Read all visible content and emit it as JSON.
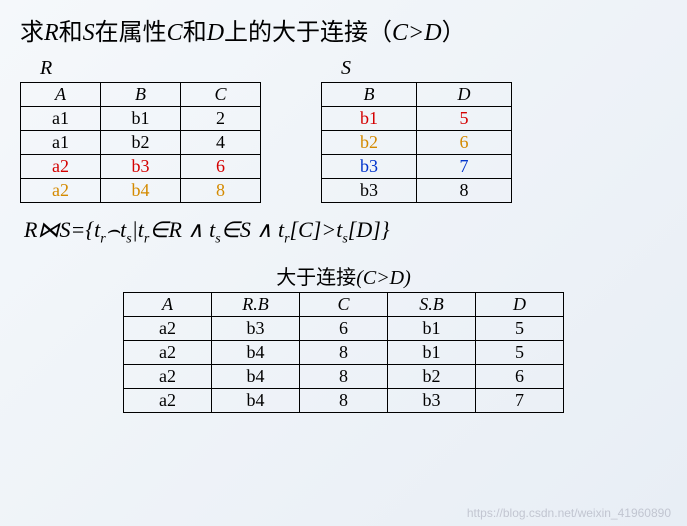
{
  "title_parts": {
    "p1": "求",
    "r": "R",
    "p2": "和",
    "s": "S",
    "p3": "在属性",
    "c": "C",
    "p4": "和",
    "d": "D",
    "p5": "上的大于连接（",
    "cond": "C>D",
    "p6": "）"
  },
  "tableR": {
    "label": "R",
    "headers": [
      "A",
      "B",
      "C"
    ],
    "rows": [
      {
        "cells": [
          "a1",
          "b1",
          "2"
        ],
        "color": "black"
      },
      {
        "cells": [
          "a1",
          "b2",
          "4"
        ],
        "color": "black"
      },
      {
        "cells": [
          "a2",
          "b3",
          "6"
        ],
        "color": "red"
      },
      {
        "cells": [
          "a2",
          "b4",
          "8"
        ],
        "color": "orange"
      }
    ]
  },
  "tableS": {
    "label": "S",
    "headers": [
      "B",
      "D"
    ],
    "rows": [
      {
        "cells": [
          "b1",
          "5"
        ],
        "color": "red"
      },
      {
        "cells": [
          "b2",
          "6"
        ],
        "color": "orange"
      },
      {
        "cells": [
          "b3",
          "7"
        ],
        "color": "blue"
      },
      {
        "cells": [
          "b3",
          "8"
        ],
        "color": "black"
      }
    ]
  },
  "formula": {
    "lhs_r": "R",
    "join": "⋈",
    "lhs_s": "S",
    "eq": "=",
    "body": "{t",
    "sub_r": "r",
    "cap": "⌢",
    "t2": "t",
    "sub_s": "s",
    "bar": "|t",
    "in1": "∈",
    "R": "R",
    "and1": "∧",
    "t3": " t",
    "in2": "∈",
    "S": "S",
    "and2": "∧",
    "t4": " t",
    "br1": "[C]",
    "gt": ">",
    "t5": "t",
    "br2": "[D]",
    "close": "}"
  },
  "result": {
    "title_cn": "大于连接",
    "title_cond": "(C>D)",
    "headers": [
      "A",
      "R.B",
      "C",
      "S.B",
      "D"
    ],
    "rows": [
      [
        "a2",
        "b3",
        "6",
        "b1",
        "5"
      ],
      [
        "a2",
        "b4",
        "8",
        "b1",
        "5"
      ],
      [
        "a2",
        "b4",
        "8",
        "b2",
        "6"
      ],
      [
        "a2",
        "b4",
        "8",
        "b3",
        "7"
      ]
    ]
  },
  "watermark": "https://blog.csdn.net/weixin_41960890",
  "chart_data": {
    "type": "table",
    "tables": [
      {
        "name": "R",
        "columns": [
          "A",
          "B",
          "C"
        ],
        "rows": [
          [
            "a1",
            "b1",
            2
          ],
          [
            "a1",
            "b2",
            4
          ],
          [
            "a2",
            "b3",
            6
          ],
          [
            "a2",
            "b4",
            8
          ]
        ]
      },
      {
        "name": "S",
        "columns": [
          "B",
          "D"
        ],
        "rows": [
          [
            "b1",
            5
          ],
          [
            "b2",
            6
          ],
          [
            "b3",
            7
          ],
          [
            "b3",
            8
          ]
        ]
      },
      {
        "name": "R⋈S (C>D)",
        "columns": [
          "A",
          "R.B",
          "C",
          "S.B",
          "D"
        ],
        "rows": [
          [
            "a2",
            "b3",
            6,
            "b1",
            5
          ],
          [
            "a2",
            "b4",
            8,
            "b1",
            5
          ],
          [
            "a2",
            "b4",
            8,
            "b2",
            6
          ],
          [
            "a2",
            "b4",
            8,
            "b3",
            7
          ]
        ]
      }
    ]
  }
}
